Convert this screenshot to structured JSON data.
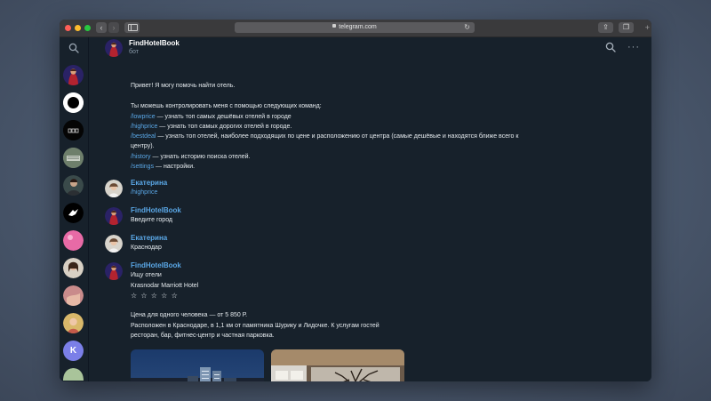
{
  "browser": {
    "url": "telegram.com"
  },
  "chat": {
    "name": "FindHotelBook",
    "status": "бот"
  },
  "intro": {
    "greeting": "Привет! Я могу помочь найти отель.",
    "commands_intro": "Ты можешь контролировать меня с помощью  следующих команд:",
    "lowprice_cmd": "/lowprice",
    "lowprice_desc": " — узнать топ самых дешёвых отелей в городе",
    "highprice_cmd": "/highprice",
    "highprice_desc": " — узнать топ самых дорогих отелей в городе.",
    "bestdeal_cmd": "/bestdeal",
    "bestdeal_desc_1": " — узнать топ отелей, наиболее подходящих по цене и расположению от центра (самые дешёвые и находятся ближе всего к",
    "bestdeal_desc_2": "центру).",
    "history_cmd": "/history",
    "history_desc": " — узнать историю поиска отелей.",
    "settings_cmd": "/settings",
    "settings_desc": " — настройки."
  },
  "messages": [
    {
      "sender": "Екатерина",
      "text": "/highprice"
    },
    {
      "sender": "FindHotelBook",
      "text": "Введите город"
    },
    {
      "sender": "Екатерина",
      "text": "Краснодар"
    },
    {
      "sender": "FindHotelBook",
      "text": "Ищу отели"
    }
  ],
  "hotel": {
    "name": "Krasnodar Marriott Hotel",
    "stars": "☆ ☆ ☆ ☆ ☆",
    "price": "Цена для одного человека — от 5 850 Р.",
    "desc_1": "Расположен в Краснодаре, в 1,1 км от памятника Шурику и Лидочке. К услугам гостей",
    "desc_2": "ресторан, бар, фитнес-центр и частная парковка."
  },
  "contacts": {
    "letter_avatar": "K"
  }
}
